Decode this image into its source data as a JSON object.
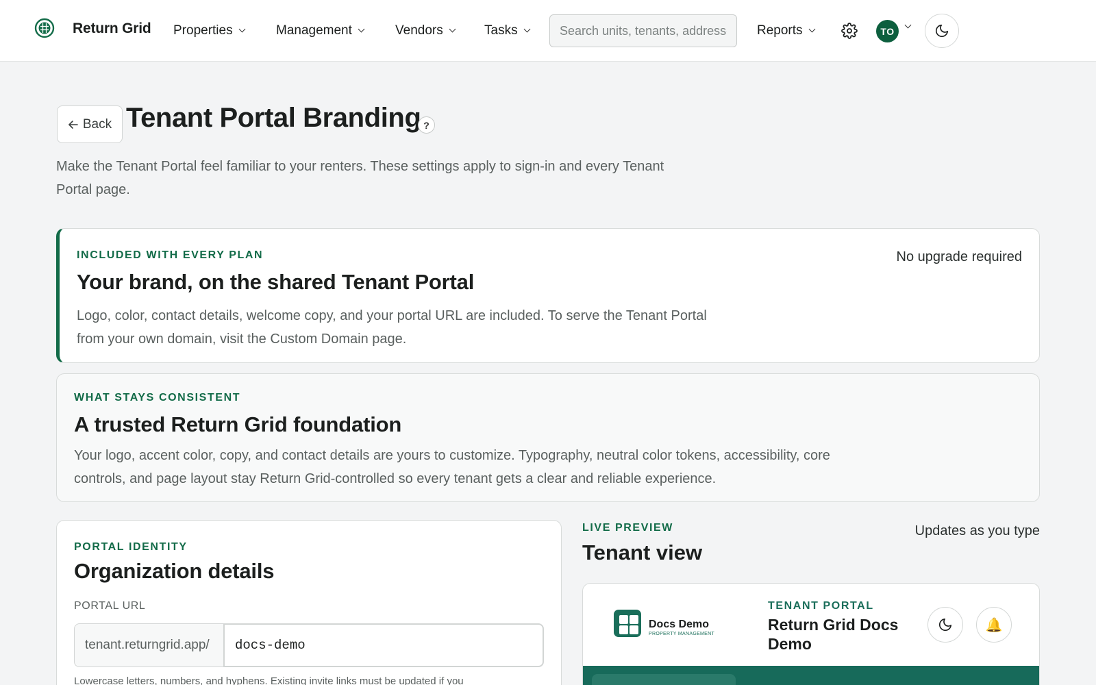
{
  "app": {
    "name": "Return Grid"
  },
  "nav": {
    "items": [
      {
        "label": "Properties"
      },
      {
        "label": "Management"
      },
      {
        "label": "Vendors"
      },
      {
        "label": "Tasks"
      }
    ],
    "search_placeholder": "Search units, tenants, addresses",
    "reports_label": "Reports",
    "avatar_initials": "TO"
  },
  "header": {
    "back_label": "Back",
    "title": "Tenant Portal Branding",
    "help_symbol": "?",
    "subtitle": "Make the Tenant Portal feel familiar to your renters. These settings apply to sign-in and every Tenant Portal page."
  },
  "plan_card": {
    "eyebrow": "INCLUDED WITH EVERY PLAN",
    "title": "Your brand, on the shared Tenant Portal",
    "body": "Logo, color, contact details, welcome copy, and your portal URL are included. To serve the Tenant Portal from your own domain, visit the Custom Domain page.",
    "note": "No upgrade required"
  },
  "consistency_card": {
    "eyebrow": "WHAT STAYS CONSISTENT",
    "title": "A trusted Return Grid foundation",
    "body": "Your logo, accent color, copy, and contact details are yours to customize. Typography, neutral color tokens, accessibility, core controls, and page layout stay Return Grid-controlled so every tenant gets a clear and reliable experience."
  },
  "identity_card": {
    "eyebrow": "PORTAL IDENTITY",
    "title": "Organization details",
    "url_label": "PORTAL URL",
    "url_prefix": "tenant.returngrid.app/",
    "url_value": "docs-demo",
    "url_help": "Lowercase letters, numbers, and hyphens. Existing invite links must be updated if you"
  },
  "preview": {
    "eyebrow": "LIVE PREVIEW",
    "title": "Tenant view",
    "note": "Updates as you type",
    "org_name": "Docs Demo",
    "org_tagline": "PROPERTY MANAGEMENT",
    "portal_eyebrow": "TENANT PORTAL",
    "portal_title": "Return Grid Docs Demo",
    "bell_glyph": "🔔"
  },
  "colors": {
    "accent": "#126b48",
    "preview_accent": "#176a5a",
    "avatar": "#0d5f3e"
  },
  "icons": [
    "grid-globe-icon",
    "chevron-down-icon",
    "gear-icon",
    "moon-icon",
    "arrow-left-icon",
    "help-icon",
    "bell-icon"
  ]
}
